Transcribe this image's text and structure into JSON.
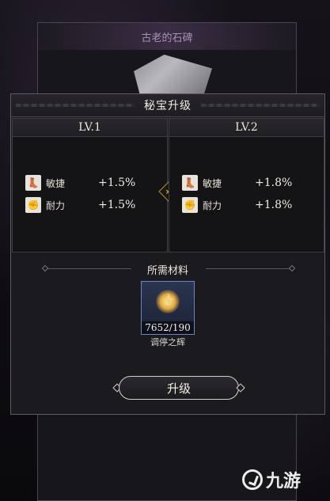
{
  "background": {
    "panel_title": "古老的石碑"
  },
  "dialog": {
    "title": "秘宝升级",
    "left": {
      "level": "LV.1",
      "stats": [
        {
          "icon": "boot-icon",
          "name": "敏捷",
          "value": "+1.5%"
        },
        {
          "icon": "fist-icon",
          "name": "耐力",
          "value": "+1.5%"
        }
      ]
    },
    "right": {
      "level": "LV.2",
      "stats": [
        {
          "icon": "boot-icon",
          "name": "敏捷",
          "value": "+1.8%"
        },
        {
          "icon": "fist-icon",
          "name": "耐力",
          "value": "+1.8%"
        }
      ]
    },
    "arrow_icon": "double-chevron-right-icon",
    "materials": {
      "title": "所需材料",
      "item": {
        "icon": "star-gem-icon",
        "count": "7652/190",
        "name": "调停之辉"
      }
    },
    "upgrade_button": "升级"
  },
  "watermark": {
    "text": "九游"
  },
  "colors": {
    "accent_gold": "#e0b640",
    "item_border": "#6a86c2"
  }
}
